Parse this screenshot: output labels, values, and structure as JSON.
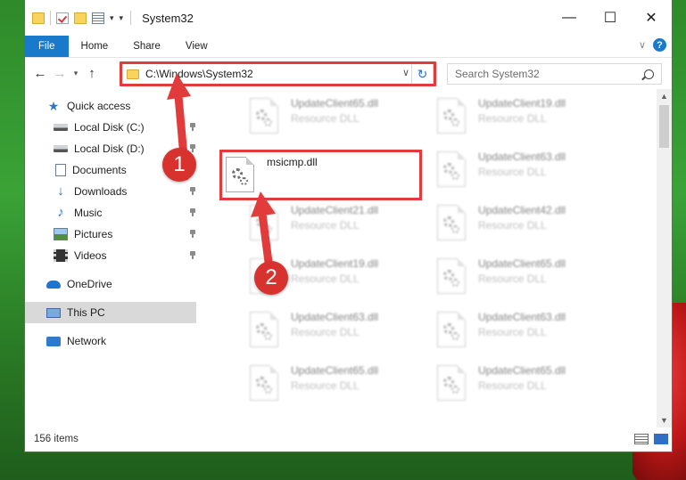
{
  "window": {
    "title": "System32",
    "controls": [
      "minimize-icon",
      "maximize-icon",
      "close-icon"
    ]
  },
  "ribbon": {
    "tabs": [
      "File",
      "Home",
      "Share",
      "View"
    ]
  },
  "address": {
    "path": "C:\\Windows\\System32",
    "search_placeholder": "Search System32"
  },
  "nav": {
    "quick_access": "Quick access",
    "items": [
      {
        "label": "Local Disk (C:)",
        "icon": "disk-icon",
        "pinned": true
      },
      {
        "label": "Local Disk (D:)",
        "icon": "disk-icon",
        "pinned": true
      },
      {
        "label": "Documents",
        "icon": "documents-icon",
        "pinned": true
      },
      {
        "label": "Downloads",
        "icon": "downloads-icon",
        "pinned": true
      },
      {
        "label": "Music",
        "icon": "music-icon",
        "pinned": true
      },
      {
        "label": "Pictures",
        "icon": "pictures-icon",
        "pinned": true
      },
      {
        "label": "Videos",
        "icon": "videos-icon",
        "pinned": true
      }
    ],
    "onedrive": "OneDrive",
    "this_pc": "This PC",
    "network": "Network"
  },
  "files": {
    "left": [
      {
        "name": "UpdateClient65.dll",
        "type": "Resource DLL"
      },
      {
        "name": "msicmp.dll",
        "type": ""
      },
      {
        "name": "UpdateClient21.dll",
        "type": "Resource DLL"
      },
      {
        "name": "UpdateClient19.dll",
        "type": "Resource DLL"
      },
      {
        "name": "UpdateClient63.dll",
        "type": "Resource DLL"
      },
      {
        "name": "UpdateClient65.dll",
        "type": "Resource DLL"
      }
    ],
    "right": [
      {
        "name": "UpdateClient19.dll",
        "type": "Resource DLL"
      },
      {
        "name": "UpdateClient63.dll",
        "type": "Resource DLL"
      },
      {
        "name": "UpdateClient42.dll",
        "type": "Resource DLL"
      },
      {
        "name": "UpdateClient65.dll",
        "type": "Resource DLL"
      },
      {
        "name": "UpdateClient63.dll",
        "type": "Resource DLL"
      },
      {
        "name": "UpdateClient65.dll",
        "type": "Resource DLL"
      }
    ]
  },
  "status": {
    "item_count": "156 items"
  },
  "annotations": {
    "step1": "1",
    "step2": "2",
    "color": "#e23b3b"
  }
}
